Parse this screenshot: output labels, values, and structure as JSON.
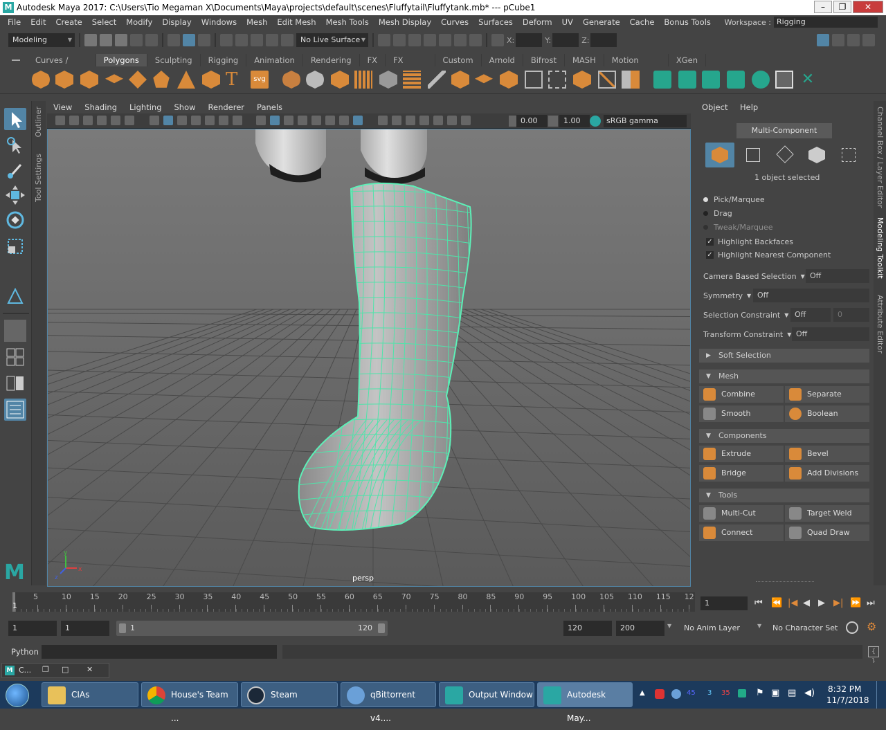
{
  "window": {
    "title": "Autodesk Maya 2017: C:\\Users\\Tio Megaman X\\Documents\\Maya\\projects\\default\\scenes\\Fluffytail\\Fluffytank.mb*   ---   pCube1",
    "logo": "M"
  },
  "menubar": [
    "File",
    "Edit",
    "Create",
    "Select",
    "Modify",
    "Display",
    "Windows",
    "Mesh",
    "Edit Mesh",
    "Mesh Tools",
    "Mesh Display",
    "Curves",
    "Surfaces",
    "Deform",
    "UV",
    "Generate",
    "Cache",
    "Bonus Tools"
  ],
  "workspace": {
    "label": "Workspace :",
    "value": "Rigging"
  },
  "statusline": {
    "mode": "Modeling",
    "live_surface": "No Live Surface",
    "x_label": "X:",
    "y_label": "Y:",
    "z_label": "Z:"
  },
  "shelf_tabs": [
    "Curves / Surfaces",
    "Polygons",
    "Sculpting",
    "Rigging",
    "Animation",
    "Rendering",
    "FX",
    "FX Caching",
    "Custom",
    "Arnold",
    "Bifrost",
    "MASH",
    "Motion Graphics",
    "XGen"
  ],
  "shelf_active": "Polygons",
  "shelf_text_icons": {
    "text": "T",
    "svg": "svg"
  },
  "side_tabs": {
    "outliner": "Outliner",
    "tool_settings": "Tool Settings",
    "channel_box": "Channel Box / Layer Editor",
    "modeling_toolkit": "Modeling Toolkit",
    "attribute_editor": "Attribute Editor"
  },
  "viewport": {
    "menu": [
      "View",
      "Shading",
      "Lighting",
      "Show",
      "Renderer",
      "Panels"
    ],
    "exposure": "0.00",
    "gamma": "1.00",
    "colorspace": "sRGB gamma",
    "camera": "persp",
    "axis_x": "x",
    "axis_y": "y",
    "axis_z": "z"
  },
  "toolkit": {
    "menu": [
      "Object",
      "Help"
    ],
    "multi_component": "Multi-Component",
    "selected_count": "1 object selected",
    "radios": [
      {
        "label": "Pick/Marquee",
        "on": true
      },
      {
        "label": "Drag",
        "on": false
      },
      {
        "label": "Tweak/Marquee",
        "on": false
      }
    ],
    "checks": [
      {
        "label": "Highlight Backfaces",
        "mark": "✓"
      },
      {
        "label": "Highlight Nearest Component",
        "mark": "✓"
      }
    ],
    "props": [
      {
        "label": "Camera Based Selection",
        "value": "Off"
      },
      {
        "label": "Symmetry",
        "value": "Off"
      },
      {
        "label": "Selection Constraint",
        "value": "Off",
        "extra": "0"
      },
      {
        "label": "Transform Constraint",
        "value": "Off"
      }
    ],
    "soft_selection": "Soft Selection",
    "mesh": {
      "title": "Mesh",
      "buttons": [
        "Combine",
        "Separate",
        "Smooth",
        "Boolean"
      ]
    },
    "components": {
      "title": "Components",
      "buttons": [
        "Extrude",
        "Bevel",
        "Bridge",
        "Add Divisions"
      ]
    },
    "tools": {
      "title": "Tools",
      "buttons": [
        "Multi-Cut",
        "Target Weld",
        "Connect",
        "Quad Draw"
      ]
    }
  },
  "timeline": {
    "ticks": [
      "5",
      "10",
      "15",
      "20",
      "25",
      "30",
      "35",
      "40",
      "45",
      "50",
      "55",
      "60",
      "65",
      "70",
      "75",
      "80",
      "85",
      "90",
      "95",
      "100",
      "105",
      "110",
      "115",
      "12"
    ],
    "playhead": "1",
    "current_frame": "1"
  },
  "range": {
    "start": "1",
    "start2": "1",
    "slider_min": "1",
    "slider_max": "120",
    "end": "120",
    "end2": "200",
    "anim_layer": "No Anim Layer",
    "char_set": "No Character Set"
  },
  "python": {
    "label": "Python"
  },
  "minibar": {
    "label": "C..."
  },
  "taskbar": {
    "items": [
      "CIAs",
      "House's Team ...",
      "Steam",
      "qBittorrent v4....",
      "Output Window",
      "Autodesk May..."
    ],
    "tray_numbers": [
      "45",
      "3",
      "35"
    ],
    "time": "8:32 PM",
    "date": "11/7/2018"
  }
}
